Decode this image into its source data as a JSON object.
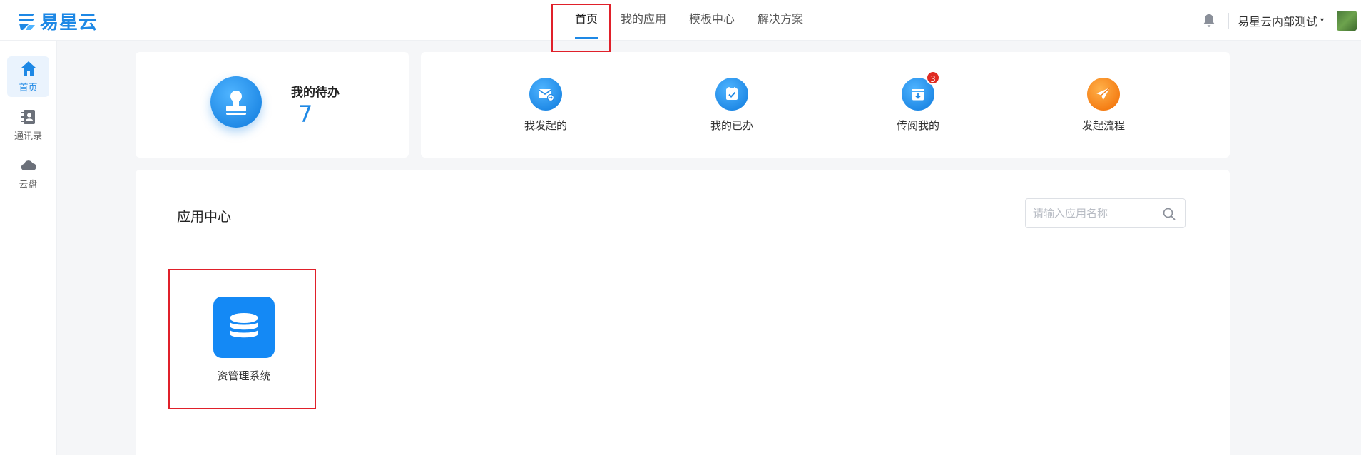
{
  "header": {
    "logo_text": "易星云",
    "nav": [
      {
        "label": "首页",
        "active": true
      },
      {
        "label": "我的应用",
        "active": false
      },
      {
        "label": "模板中心",
        "active": false
      },
      {
        "label": "解决方案",
        "active": false
      }
    ],
    "user_name": "易星云内部测试",
    "caret": "▾"
  },
  "sidebar": {
    "items": [
      {
        "label": "首页",
        "icon": "home-icon",
        "active": true
      },
      {
        "label": "通讯录",
        "icon": "contacts-icon",
        "active": false
      },
      {
        "label": "云盘",
        "icon": "cloud-icon",
        "active": false
      }
    ]
  },
  "todo": {
    "title": "我的待办",
    "count": "7"
  },
  "quick_actions": [
    {
      "label": "我发起的",
      "icon": "mail-send-icon",
      "color": "#1e88e5"
    },
    {
      "label": "我的已办",
      "icon": "calendar-check-icon",
      "color": "#1e88e5"
    },
    {
      "label": "传阅我的",
      "icon": "inbox-download-icon",
      "color": "#1e88e5",
      "badge": "3"
    },
    {
      "label": "发起流程",
      "icon": "paper-plane-icon",
      "color": "#f47b12"
    }
  ],
  "app_center": {
    "title": "应用中心",
    "search_placeholder": "请输入应用名称",
    "apps": [
      {
        "label": "资管理系统",
        "icon": "database-icon",
        "color": "#1489f5"
      }
    ]
  },
  "colors": {
    "accent": "#1e88e5",
    "highlight_box": "#e0202a",
    "badge": "#e02b22"
  }
}
